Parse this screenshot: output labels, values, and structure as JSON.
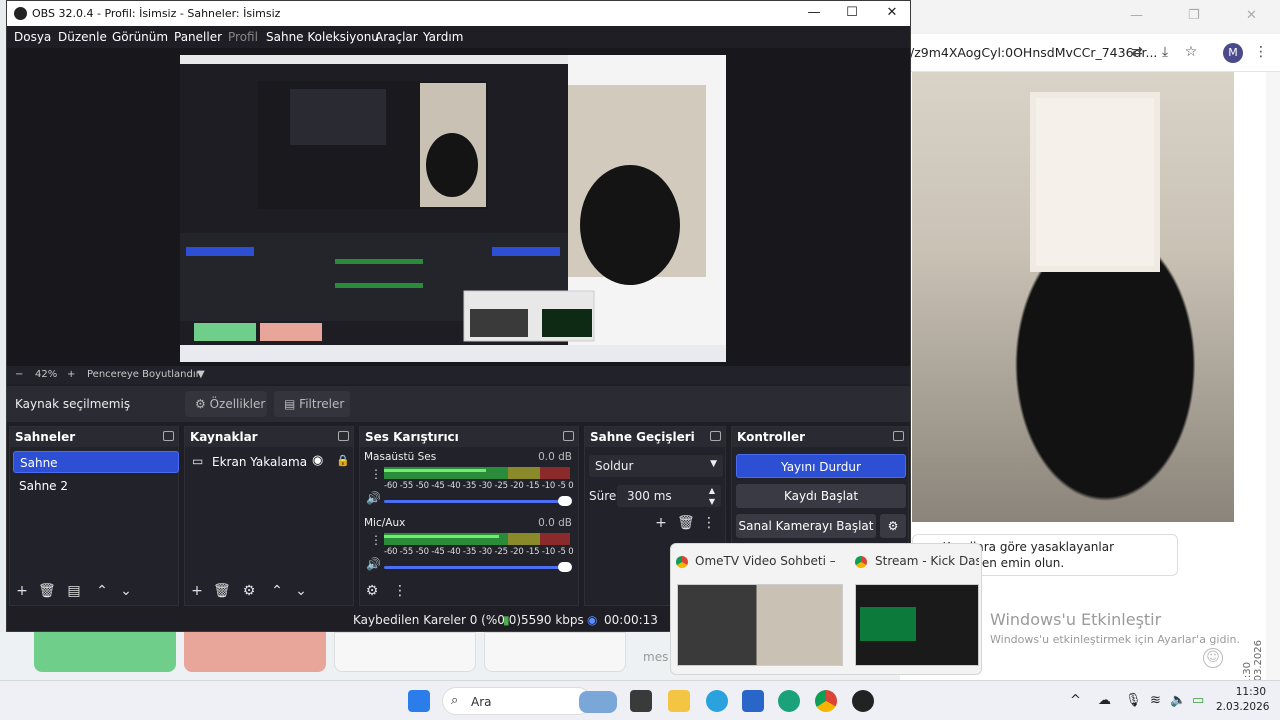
{
  "obs": {
    "title": "OBS 32.0.4 - Profil: İsimsiz - Sahneler: İsimsiz",
    "menu": [
      "Dosya",
      "Düzenle",
      "Görünüm",
      "Paneller",
      "Profil",
      "Sahne Koleksiyonu",
      "Araçlar",
      "Yardım"
    ],
    "zoom": {
      "minus": "−",
      "value": "42%",
      "plus": "+",
      "fit_label": "Pencereye Boyutlandır"
    },
    "source_bar": {
      "no_selection": "Kaynak seçilmemiş",
      "properties": "Özellikler",
      "filters": "Filtreler"
    },
    "scenes": {
      "title": "Sahneler",
      "items": [
        "Sahne",
        "Sahne 2"
      ],
      "selected": 0
    },
    "sources": {
      "title": "Kaynaklar",
      "items": [
        {
          "label": "Ekran Yakalama",
          "visible": true,
          "locked": true
        }
      ]
    },
    "mixer": {
      "title": "Ses Karıştırıcı",
      "tracks": [
        {
          "name": "Masaüstü Ses",
          "db": "0.0 dB",
          "level": 0.55
        },
        {
          "name": "Mic/Aux",
          "db": "0.0 dB",
          "level": 0.62
        }
      ],
      "ticks": "-60 -55 -50 -45 -40 -35 -30 -25 -20 -15 -10 -5 0"
    },
    "transitions": {
      "title": "Sahne Geçişleri",
      "type": "Soldur",
      "duration_label": "Süre",
      "duration": "300 ms"
    },
    "controls": {
      "title": "Kontroller",
      "stop_stream": "Yayını Durdur",
      "start_record": "Kaydı Başlat",
      "virtual_cam": "Sanal Kamerayı Başlat"
    },
    "status": {
      "dropped": "Kaybedilen Kareler 0 (%0.0)",
      "bitrate": "5590 kbps",
      "time": "00:00:13"
    }
  },
  "browser": {
    "url": "/z9m4XAogCyl:0OHnsdMvCCr_7436dr...",
    "avatar": "M",
    "chat": "uz. Kurallara göre yasaklayanlar nüdüğünden emin olun.",
    "activate_title": "Windows'u Etkinleştir",
    "activate_sub": "Windows'u etkinleştirmek için Ayarlar'a gidin."
  },
  "thumbnails": [
    {
      "title": "OmeTV Video Sohbeti —..."
    },
    {
      "title": "Stream - Kick Das..."
    }
  ],
  "taskbar": {
    "search": "Ara",
    "time": "11:30",
    "date": "2.03.2026",
    "side_date": "11:30 2.03.2026",
    "bg_text": "mes"
  },
  "colors": {
    "accent": "#2d4fd4",
    "obs_bg": "#1e1e24",
    "panel": "#22222a"
  }
}
